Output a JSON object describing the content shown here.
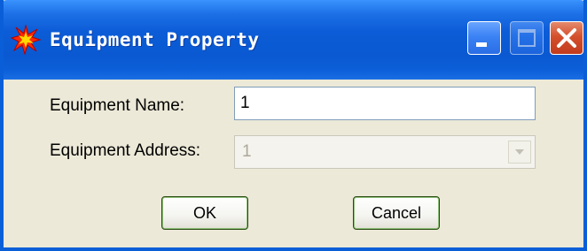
{
  "window": {
    "title": "Equipment Property",
    "controls": {
      "minimize_icon": "minimize-icon",
      "maximize_icon": "maximize-icon",
      "close_icon": "close-icon"
    },
    "app_icon": "explosion-star-icon"
  },
  "form": {
    "name_label": "Equipment Name:",
    "name_value": "1",
    "address_label": "Equipment Address:",
    "address_value": "1"
  },
  "buttons": {
    "ok_label": "OK",
    "cancel_label": "Cancel"
  },
  "colors": {
    "titlebar": "#0a5fd8",
    "dialog_background": "#ece9d8",
    "close_button": "#d4502d"
  }
}
